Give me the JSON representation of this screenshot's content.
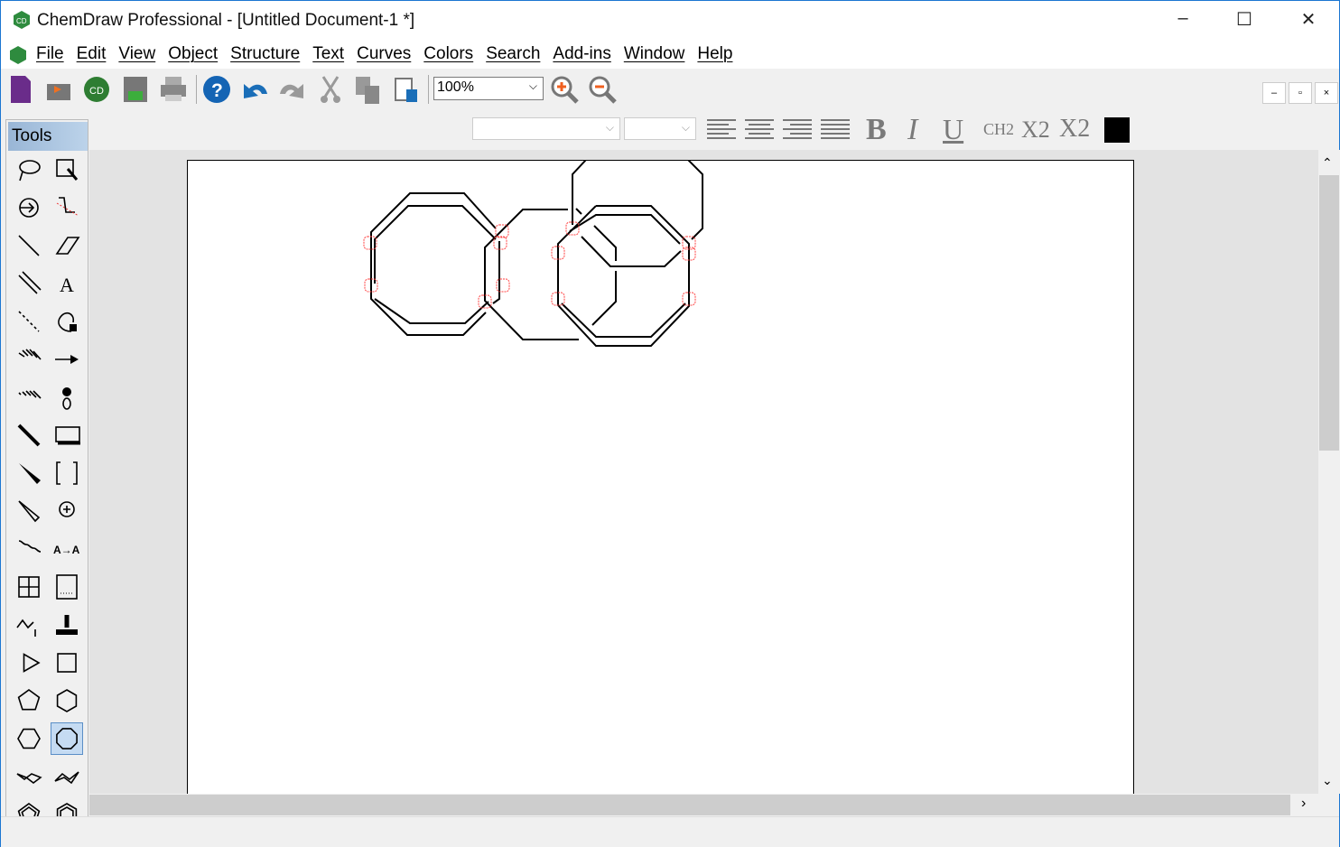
{
  "window": {
    "title": "ChemDraw Professional - [Untitled Document-1 *]",
    "minimize": "–",
    "maximize": "☐",
    "close": "✕"
  },
  "menu": [
    "File",
    "Edit",
    "View",
    "Object",
    "Structure",
    "Text",
    "Curves",
    "Colors",
    "Search",
    "Add-ins",
    "Window",
    "Help"
  ],
  "mdi": {
    "minimize": "–",
    "restore": "▫",
    "close": "×"
  },
  "toolbar": {
    "icons": [
      "new-document-icon",
      "open-icon",
      "chemdraw-cloud-icon",
      "save-icon",
      "print-icon",
      "help-icon",
      "undo-icon",
      "redo-icon",
      "cut-icon",
      "copy-icon",
      "paste-icon"
    ],
    "zoom": "100%",
    "zoom_in": "zoom-in-icon",
    "zoom_out": "zoom-out-icon"
  },
  "format": {
    "font_value": "",
    "size_value": "",
    "bold": "B",
    "italic": "I",
    "underline": "U",
    "formula": "CH2",
    "subscript": "X2",
    "superscript": "X2",
    "color": "#000000"
  },
  "tools": {
    "header": "Tools",
    "selected": "octagon",
    "items": [
      "lasso",
      "marquee",
      "structure-perspective",
      "acyclic-chain",
      "solid-bond",
      "eraser",
      "double-bond",
      "text",
      "dashed-bond",
      "pen",
      "hashed-bond",
      "arrow",
      "hashed-wedge-bond",
      "orbital",
      "bold-bond",
      "drawing-elements",
      "wedge-bond",
      "brackets",
      "hollow-wedge-bond",
      "chemical-symbols",
      "wavy-bond",
      "atom-mapping",
      "table",
      "tlc-plate",
      "mass-fragmentation",
      "template-stamp",
      "cyclopropane",
      "cyclobutane",
      "cyclopentane",
      "cyclohexane",
      "cycloheptane",
      "octagon",
      "chair-cyclohexane-1",
      "chair-cyclohexane-2",
      "cyclopentadiene",
      "benzene"
    ]
  },
  "colors": {
    "accent": "#1b76d1",
    "selection": "#ff4040",
    "tools_header": "#99b6d6"
  }
}
